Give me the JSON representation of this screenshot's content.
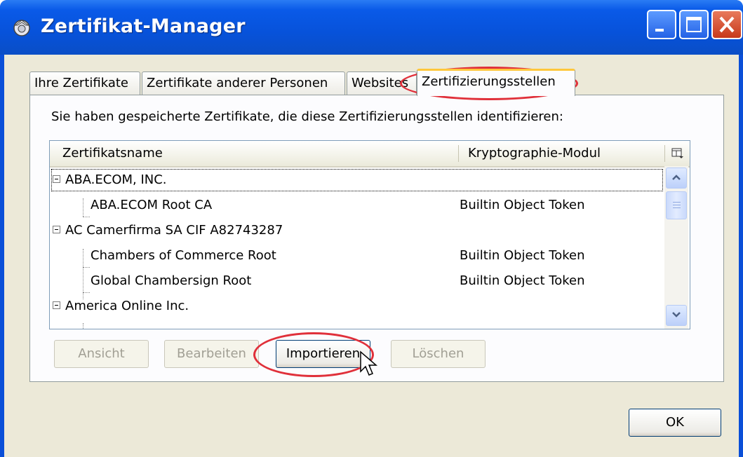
{
  "window": {
    "title": "Zertifikat-Manager",
    "buttons": [
      "minimize",
      "maximize",
      "close"
    ]
  },
  "tabs": [
    {
      "label": "Ihre Zertifikate",
      "active": false
    },
    {
      "label": "Zertifikate anderer Personen",
      "active": false
    },
    {
      "label": "Websites",
      "active": false
    },
    {
      "label": "Zertifizierungsstellen",
      "active": true
    }
  ],
  "panel": {
    "description": "Sie haben gespeicherte Zertifikate, die diese Zertifizierungsstellen identifizieren:",
    "columns": {
      "name": "Zertifikatsname",
      "module": "Kryptographie-Modul"
    },
    "rows": [
      {
        "type": "group",
        "name": "ABA.ECOM, INC.",
        "module": "",
        "selected": true
      },
      {
        "type": "item",
        "name": "ABA.ECOM Root CA",
        "module": "Builtin Object Token"
      },
      {
        "type": "group",
        "name": "AC Camerfirma SA CIF A82743287",
        "module": ""
      },
      {
        "type": "item",
        "name": "Chambers of Commerce Root",
        "module": "Builtin Object Token"
      },
      {
        "type": "item",
        "name": "Global Chambersign Root",
        "module": "Builtin Object Token"
      },
      {
        "type": "group",
        "name": "America Online Inc.",
        "module": ""
      }
    ]
  },
  "actions": {
    "view": "Ansicht",
    "edit": "Bearbeiten",
    "import": "Importieren",
    "delete": "Löschen"
  },
  "ok_label": "OK",
  "colors": {
    "titlebar": "#0a5ae8",
    "client_bg": "#ece9d8",
    "highlight": "#e0303a",
    "active_tab_accent": "#ffc73c"
  },
  "icons": {
    "window": "certificate-manager-icon",
    "column_picker": "column-picker-icon",
    "cursor": "mouse-pointer-icon"
  }
}
